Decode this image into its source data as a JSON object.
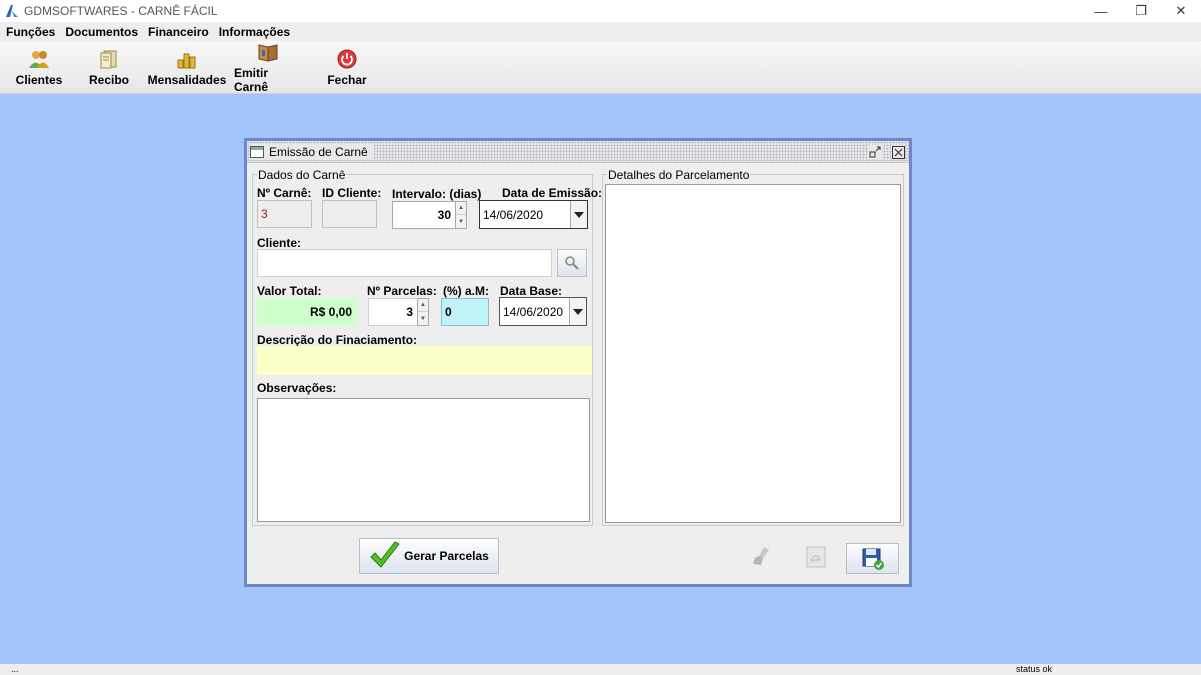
{
  "window": {
    "title": "GDMSOFTWARES - CARNÊ FÁCIL",
    "minimize": "—",
    "restore": "❐",
    "close": "✕"
  },
  "menu": [
    "Funções",
    "Documentos",
    "Financeiro",
    "Informações"
  ],
  "toolbar": [
    {
      "label": "Clientes",
      "icon": "clients-icon"
    },
    {
      "label": "Recibo",
      "icon": "receipt-icon"
    },
    {
      "label": "Mensalidades",
      "icon": "coins-icon"
    },
    {
      "label": "Emitir Carnê",
      "icon": "book-icon"
    },
    {
      "label": "Fechar",
      "icon": "power-icon"
    }
  ],
  "frame": {
    "title": "Emissão de Carnê",
    "dados": {
      "legend": "Dados do Carnê",
      "n_carne_label": "Nº Carnê:",
      "n_carne_value": "3",
      "id_cliente_label": "ID Cliente:",
      "id_cliente_value": "",
      "intervalo_label": "Intervalo: (dias)",
      "intervalo_value": "30",
      "data_emissao_label": "Data de Emissão:",
      "data_emissao_value": "14/06/2020",
      "cliente_label": "Cliente:",
      "cliente_value": "",
      "valor_total_label": "Valor Total:",
      "valor_total_value": "R$ 0,00",
      "n_parcelas_label": "Nº Parcelas:",
      "n_parcelas_value": "3",
      "taxa_label": "(%) a.M:",
      "taxa_value": "0",
      "data_base_label": "Data Base:",
      "data_base_value": "14/06/2020",
      "descricao_label": "Descrição do Finaciamento:",
      "descricao_value": "",
      "observacoes_label": "Observações:",
      "observacoes_value": ""
    },
    "detalhes": {
      "legend": "Detalhes do Parcelamento"
    },
    "gerar_label": "Gerar Parcelas"
  },
  "status": {
    "left": "...",
    "right": "status ok"
  },
  "colors": {
    "desktop": "#a4c5fb",
    "frame_border": "#6f87c9",
    "valor_bg": "#ccffcc",
    "taxa_bg": "#bff3f8",
    "descricao_bg": "#fdffc9",
    "n_carne_text": "#8b1a1a"
  }
}
